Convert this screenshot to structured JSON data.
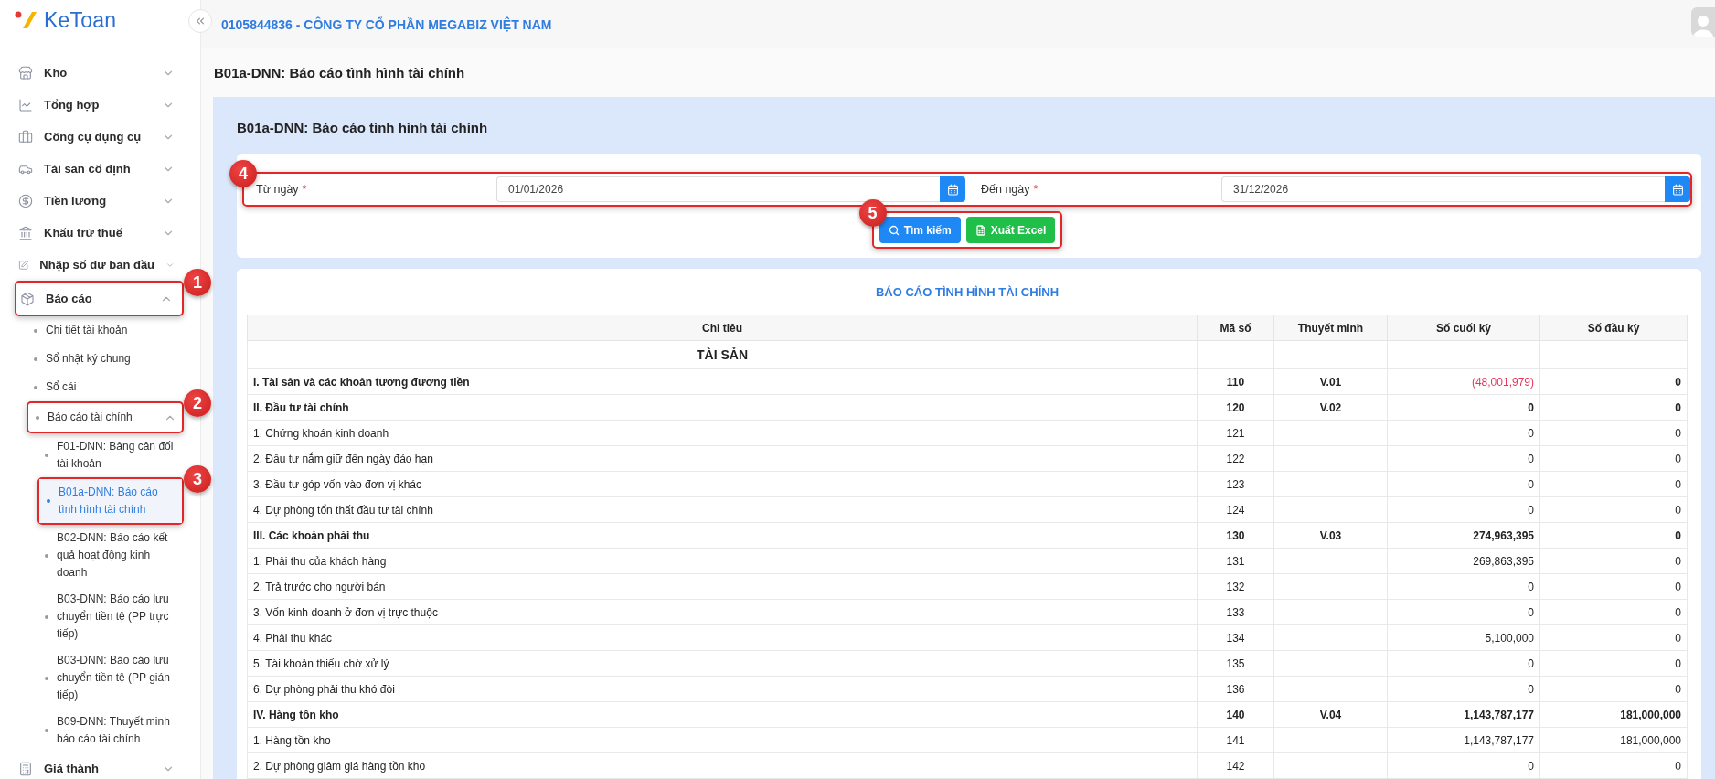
{
  "logo": {
    "text": "KeToan"
  },
  "header": {
    "company": "0105844836 - CÔNG TY CỔ PHẦN MEGABIZ VIỆT NAM"
  },
  "sidebar": {
    "items": [
      {
        "label": "Kho",
        "expanded": false
      },
      {
        "label": "Tổng hợp",
        "expanded": false
      },
      {
        "label": "Công cụ dụng cụ",
        "expanded": false
      },
      {
        "label": "Tài sản cố định",
        "expanded": false
      },
      {
        "label": "Tiền lương",
        "expanded": false
      },
      {
        "label": "Khấu trừ thuế",
        "expanded": false
      },
      {
        "label": "Nhập số dư ban đầu",
        "expanded": false
      },
      {
        "label": "Báo cáo",
        "expanded": true,
        "callout": "1",
        "children": [
          {
            "label": "Chi tiết tài khoản",
            "selected": false
          },
          {
            "label": "Sổ nhật ký chung",
            "selected": false
          },
          {
            "label": "Sổ cái",
            "selected": false
          },
          {
            "label": "Báo cáo tài chính",
            "selected": false,
            "expanded": true,
            "callout": "2",
            "children": [
              {
                "label": "F01-DNN: Bảng cân đối tài khoản",
                "selected": false
              },
              {
                "label": "B01a-DNN: Báo cáo tình hình tài chính",
                "selected": true,
                "callout": "3"
              },
              {
                "label": "B02-DNN: Báo cáo kết quả hoạt động kinh doanh",
                "selected": false
              },
              {
                "label": "B03-DNN: Báo cáo lưu chuyển tiền tệ (PP trực tiếp)",
                "selected": false
              },
              {
                "label": "B03-DNN: Báo cáo lưu chuyển tiền tệ (PP gián tiếp)",
                "selected": false
              },
              {
                "label": "B09-DNN: Thuyết minh báo cáo tài chính",
                "selected": false
              }
            ]
          }
        ]
      },
      {
        "label": "Giá thành",
        "expanded": false
      }
    ]
  },
  "page_title": "B01a-DNN: Báo cáo tình hình tài chính",
  "panel": {
    "title": "B01a-DNN: Báo cáo tình hình tài chính",
    "filters": {
      "callout": "4",
      "fields": [
        {
          "label": "Từ ngày",
          "required_mark": "*",
          "value": "01/01/2026"
        },
        {
          "label": "Đến ngày",
          "required_mark": "*",
          "value": "31/12/2026"
        }
      ]
    },
    "actions": {
      "callout": "5",
      "buttons": [
        {
          "label": "Tìm kiếm",
          "kind": "search"
        },
        {
          "label": "Xuất Excel",
          "kind": "excel"
        }
      ]
    }
  },
  "report": {
    "title": "BÁO CÁO TÌNH HÌNH TÀI CHÍNH",
    "columns": [
      "Chỉ tiêu",
      "Mã số",
      "Thuyết minh",
      "Số cuối kỳ",
      "Số đầu kỳ"
    ],
    "rows": [
      {
        "kind": "section",
        "label": "TÀI SẢN"
      },
      {
        "kind": "group",
        "label": "I. Tài sản và các khoản tương đương tiền",
        "code": "110",
        "note": "V.01",
        "end": "(48,001,979)",
        "end_negative": true,
        "begin": "0"
      },
      {
        "kind": "group",
        "label": "II. Đầu tư tài chính",
        "code": "120",
        "note": "V.02",
        "end": "0",
        "end_negative": false,
        "begin": "0"
      },
      {
        "kind": "item",
        "label": "1. Chứng khoán kinh doanh",
        "code": "121",
        "end": "0",
        "end_negative": false,
        "begin": "0"
      },
      {
        "kind": "item",
        "label": "2. Đầu tư nắm giữ đến ngày đáo hạn",
        "code": "122",
        "end": "0",
        "end_negative": false,
        "begin": "0"
      },
      {
        "kind": "item",
        "label": "3. Đầu tư góp vốn vào đơn vị khác",
        "code": "123",
        "end": "0",
        "end_negative": false,
        "begin": "0"
      },
      {
        "kind": "item",
        "label": "4. Dự phòng tổn thất đầu tư tài chính",
        "code": "124",
        "end": "0",
        "end_negative": false,
        "begin": "0"
      },
      {
        "kind": "group",
        "label": "III. Các khoản phải thu",
        "code": "130",
        "note": "V.03",
        "end": "274,963,395",
        "end_negative": false,
        "begin": "0"
      },
      {
        "kind": "item",
        "label": "1. Phải thu của khách hàng",
        "code": "131",
        "end": "269,863,395",
        "end_negative": false,
        "begin": "0"
      },
      {
        "kind": "item",
        "label": "2. Trả trước cho người bán",
        "code": "132",
        "end": "0",
        "end_negative": false,
        "begin": "0"
      },
      {
        "kind": "item",
        "label": "3. Vốn kinh doanh ở đơn vị trực thuộc",
        "code": "133",
        "end": "0",
        "end_negative": false,
        "begin": "0"
      },
      {
        "kind": "item",
        "label": "4. Phải thu khác",
        "code": "134",
        "end": "5,100,000",
        "end_negative": false,
        "begin": "0"
      },
      {
        "kind": "item",
        "label": "5. Tài khoản thiếu chờ xử lý",
        "code": "135",
        "end": "0",
        "end_negative": false,
        "begin": "0"
      },
      {
        "kind": "item",
        "label": "6. Dự phòng phải thu khó đòi",
        "code": "136",
        "end": "0",
        "end_negative": false,
        "begin": "0"
      },
      {
        "kind": "group",
        "label": "IV. Hàng tồn kho",
        "code": "140",
        "note": "V.04",
        "end": "1,143,787,177",
        "end_negative": false,
        "begin": "181,000,000"
      },
      {
        "kind": "item",
        "label": "1. Hàng tồn kho",
        "code": "141",
        "end": "1,143,787,177",
        "end_negative": false,
        "begin": "181,000,000"
      },
      {
        "kind": "item",
        "label": "2. Dự phòng giảm giá hàng tồn kho",
        "code": "142",
        "end": "0",
        "end_negative": false,
        "begin": "0"
      }
    ]
  }
}
